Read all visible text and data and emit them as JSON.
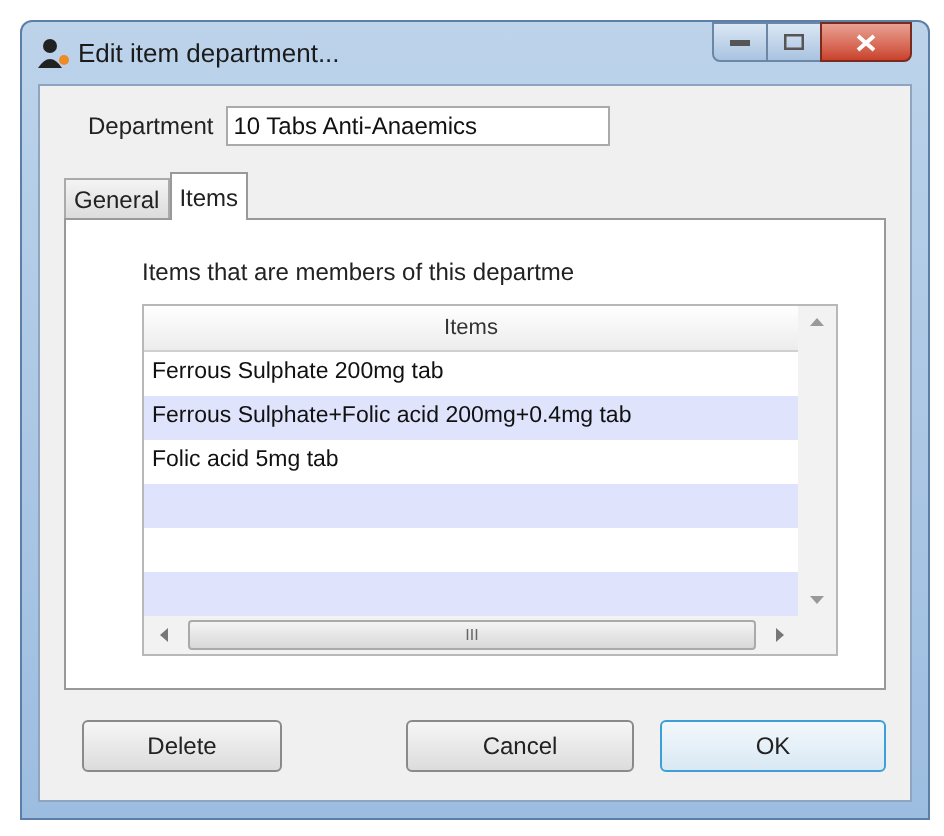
{
  "window": {
    "title": "Edit item department..."
  },
  "department": {
    "label": "Department",
    "value": "10 Tabs Anti-Anaemics"
  },
  "tabs": [
    {
      "label": "General",
      "selected": false
    },
    {
      "label": "Items",
      "selected": true
    }
  ],
  "items_panel": {
    "caption": "Items that are members of this departme",
    "columns": [
      "Items"
    ],
    "rows": [
      "Ferrous Sulphate 200mg tab",
      "Ferrous Sulphate+Folic acid 200mg+0.4mg tab",
      "Folic acid 5mg tab"
    ],
    "scroll_grip": "III"
  },
  "buttons": [
    {
      "label": "Delete",
      "kind": "plain"
    },
    {
      "label": "Cancel",
      "kind": "plain"
    },
    {
      "label": "OK",
      "kind": "default"
    }
  ]
}
